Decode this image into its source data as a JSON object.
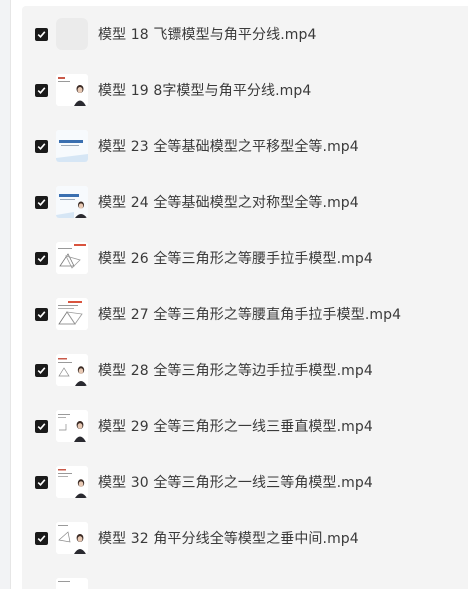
{
  "files": [
    {
      "name": "模型 18 飞镖模型与角平分线.mp4",
      "checked": true,
      "thumb": "blank-thumbnail"
    },
    {
      "name": "模型 19 8字模型与角平分线.mp4",
      "checked": true,
      "thumb": "slide-person-thumbnail"
    },
    {
      "name": "模型 23 全等基础模型之平移型全等.mp4",
      "checked": true,
      "thumb": "thanks-slide-thumbnail"
    },
    {
      "name": "模型 24 全等基础模型之对称型全等.mp4",
      "checked": true,
      "thumb": "thanks-slide-thumbnail"
    },
    {
      "name": "模型 26 全等三角形之等腰手拉手模型.mp4",
      "checked": true,
      "thumb": "diagram-slide-thumbnail"
    },
    {
      "name": "模型 27 全等三角形之等腰直角手拉手模型.mp4",
      "checked": true,
      "thumb": "diagram-slide-thumbnail"
    },
    {
      "name": "模型 28 全等三角形之等边手拉手模型.mp4",
      "checked": true,
      "thumb": "slide-person-thumbnail"
    },
    {
      "name": "模型 29 全等三角形之一线三垂直模型.mp4",
      "checked": true,
      "thumb": "slide-person-thumbnail"
    },
    {
      "name": "模型 30 全等三角形之一线三等角模型.mp4",
      "checked": true,
      "thumb": "slide-person-thumbnail"
    },
    {
      "name": "模型 32 角平分线全等模型之垂中间.mp4",
      "checked": true,
      "thumb": "slide-person-thumbnail"
    }
  ],
  "colors": {
    "panel_bg": "#f4f4f4",
    "checkbox_fill": "#1a1a1a",
    "text": "#3a3a3a"
  }
}
